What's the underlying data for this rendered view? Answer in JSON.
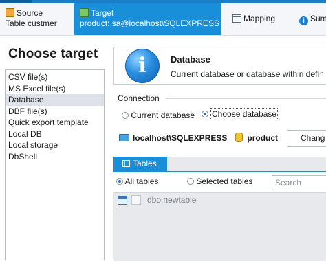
{
  "wizard": {
    "steps": [
      {
        "name": "Source",
        "detail": "Table custmer",
        "icon": "source-icon"
      },
      {
        "name": "Target",
        "detail": "product: sa@localhost\\SQLEXPRESS",
        "icon": "target-icon",
        "active": true
      },
      {
        "name": "Mapping",
        "icon": "mapping-icon"
      },
      {
        "name": "Sum",
        "icon": "summary-info-icon"
      }
    ]
  },
  "left": {
    "title": "Choose target",
    "items": [
      {
        "label": "CSV file(s)"
      },
      {
        "label": "MS Excel file(s)"
      },
      {
        "label": "Database",
        "selected": true
      },
      {
        "label": "DBF file(s)"
      },
      {
        "label": "Quick export template"
      },
      {
        "label": "Local DB"
      },
      {
        "label": "Local storage"
      },
      {
        "label": "DbShell"
      }
    ]
  },
  "header": {
    "icon": "info-icon",
    "icon_glyph": "i",
    "title": "Database",
    "description": "Current database or database within defin"
  },
  "connection": {
    "label": "Connection",
    "option_current": "Current database",
    "option_choose": "Choose database",
    "selected_option": "choose",
    "server": "localhost\\SQLEXPRESS",
    "database": "product",
    "change_label": "Chang"
  },
  "tables": {
    "tab_label": "Tables",
    "filter_all": "All tables",
    "filter_selected": "Selected tables",
    "selected_filter": "all",
    "search_placeholder": "Search",
    "rows": [
      {
        "name": "dbo.newtable",
        "checked": false
      }
    ]
  },
  "colors": {
    "accent": "#1a8fd9",
    "active_tab_text": "#ffffff",
    "list_selection": "#dde2e8"
  }
}
